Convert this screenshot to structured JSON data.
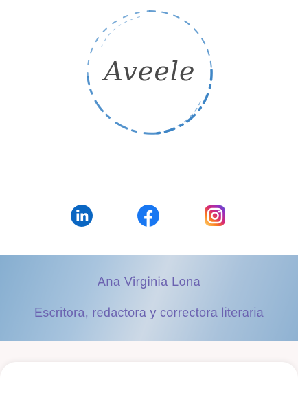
{
  "logo": {
    "text": "Aveele",
    "icon": "brand-logo-circle"
  },
  "social": [
    {
      "name": "LinkedIn",
      "icon": "linkedin-icon",
      "color": "#0a66c2"
    },
    {
      "name": "Facebook",
      "icon": "facebook-icon",
      "color": "#1877f2"
    },
    {
      "name": "Instagram",
      "icon": "instagram-icon",
      "color": "#c13584"
    }
  ],
  "banner": {
    "name": "Ana Virginia Lona",
    "role": "Escritora, redactora y correctora literaria",
    "text_color": "#6b62b0"
  }
}
